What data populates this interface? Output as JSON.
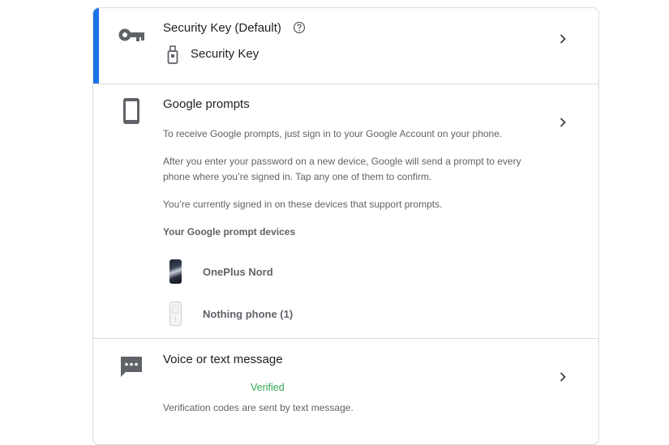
{
  "security_key": {
    "title": "Security Key (Default)",
    "help_icon": "help-circle-icon",
    "key_name": "Security Key",
    "icon": "key-icon",
    "device_icon": "usb-key-icon",
    "accent_color": "#1a73e8"
  },
  "google_prompts": {
    "title": "Google prompts",
    "icon": "phone-icon",
    "description": "To receive Google prompts, just sign in to your Google Account on your phone.",
    "detail_line1": "After you enter your password on a new device, Google will send a prompt to every",
    "detail_line2": "phone where you’re signed in. Tap any one of them to confirm.",
    "signed_in_text": "You’re currently signed in on these devices that support prompts.",
    "devices_heading": "Your Google prompt devices",
    "devices": [
      {
        "name": "OnePlus Nord",
        "icon": "oneplus-nord-thumbnail"
      },
      {
        "name": "Nothing phone (1)",
        "icon": "nothing-phone-thumbnail"
      }
    ]
  },
  "voice_text": {
    "title": "Voice or text message",
    "icon": "sms-icon",
    "status": "Verified",
    "status_color": "#34a853",
    "description": "Verification codes are sent by text message."
  },
  "chevron_icon": "chevron-right-icon"
}
